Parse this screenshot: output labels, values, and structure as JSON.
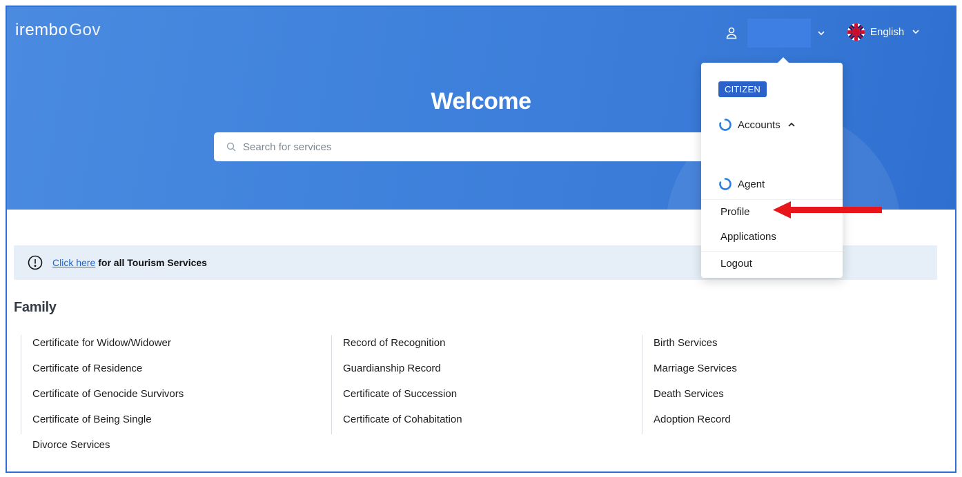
{
  "header": {
    "brand": "irembo",
    "brand_suffix": "Gov",
    "user_name": "",
    "language": "English"
  },
  "hero": {
    "title": "Welcome",
    "search_placeholder": "Search for services"
  },
  "user_menu": {
    "role_badge": "CITIZEN",
    "accounts_label": "Accounts",
    "agent_label": "Agent",
    "items": [
      "Profile",
      "Applications",
      "Logout"
    ]
  },
  "banner": {
    "link_text": "Click here",
    "text": "for all Tourism Services"
  },
  "section": {
    "title": "Family",
    "columns": [
      [
        "Certificate for Widow/Widower",
        "Certificate of Residence",
        "Certificate of Genocide Survivors",
        "Certificate of Being Single",
        "Divorce Services"
      ],
      [
        "Record of Recognition",
        "Guardianship Record",
        "Certificate of Succession",
        "Certificate of Cohabitation"
      ],
      [
        "Birth Services",
        "Marriage Services",
        "Death Services",
        "Adoption Record"
      ]
    ]
  },
  "colors": {
    "hero_blue": "#3f82dc",
    "badge_blue": "#2b62c9",
    "link_blue": "#1a67d6",
    "annotation_red": "#e8161b",
    "banner_bg": "#e6eef7"
  }
}
